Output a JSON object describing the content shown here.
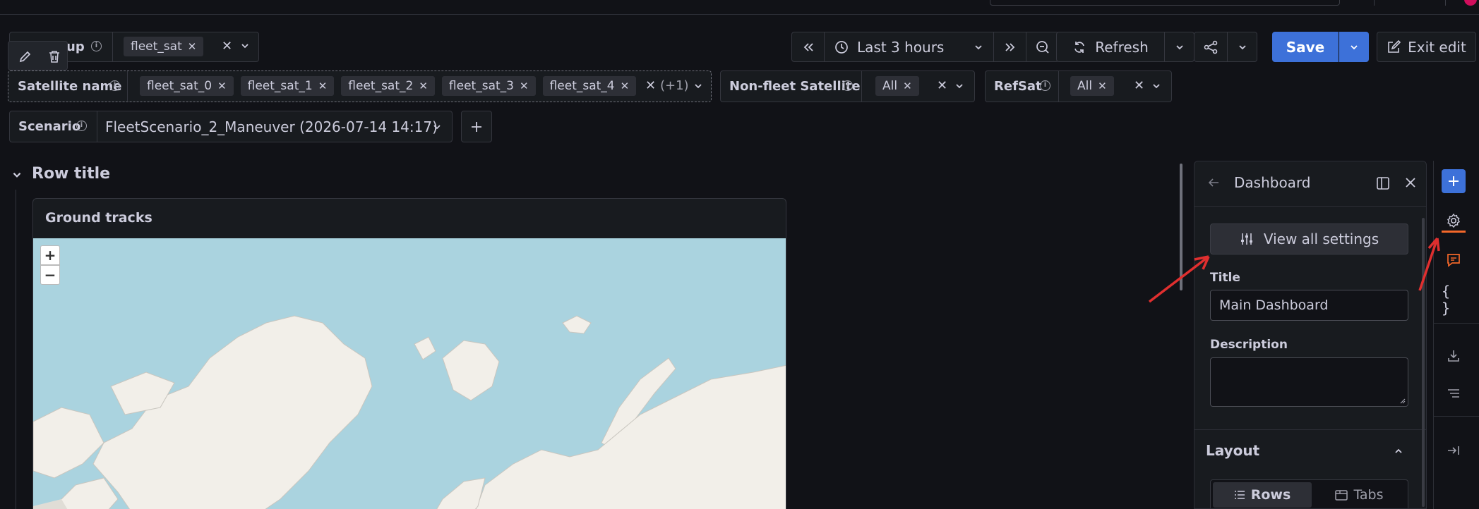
{
  "variables": {
    "group": {
      "label_visible": "up",
      "chip": "fleet_sat"
    },
    "satellite": {
      "label": "Satellite name",
      "chips": [
        "fleet_sat_0",
        "fleet_sat_1",
        "fleet_sat_2",
        "fleet_sat_3",
        "fleet_sat_4"
      ],
      "more": "(+1)"
    },
    "nonfleet": {
      "label": "Non-fleet Satellite",
      "chip": "All"
    },
    "refsat": {
      "label": "RefSat",
      "chip": "All"
    },
    "scenario": {
      "label": "Scenario",
      "value": "FleetScenario_2_Maneuver (2026-07-14 14:17)"
    }
  },
  "toolbar": {
    "time_range": "Last 3 hours",
    "refresh": "Refresh",
    "save": "Save",
    "exit": "Exit edit"
  },
  "row": {
    "title": "Row title"
  },
  "panel": {
    "title": "Ground tracks",
    "zoom_in": "+",
    "zoom_out": "−"
  },
  "sidebar": {
    "header": "Dashboard",
    "view_all": "View all settings",
    "title_label": "Title",
    "title_value": "Main Dashboard",
    "description_label": "Description",
    "layout_label": "Layout",
    "rows_label": "Rows",
    "tabs_label": "Tabs"
  },
  "colors": {
    "accent": "#3d71d9",
    "annotation_arrow": "#e02f2f",
    "orange_icon": "#f5682a",
    "map_water": "#aad3df",
    "map_land": "#f2efe9"
  }
}
